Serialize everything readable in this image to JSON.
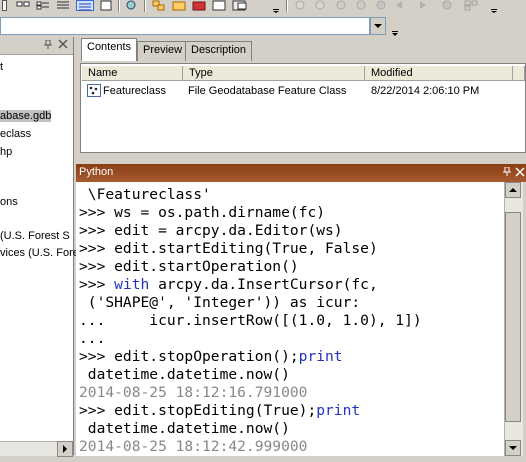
{
  "toolbar": {
    "icons": [
      "view-list-icon",
      "view-details-icon",
      "view-thumbnails-icon",
      "connect-icon",
      "tree-icon",
      "delete-icon",
      "refresh-icon",
      "zoom-in-icon",
      "zoom-out-icon",
      "pan-icon",
      "stop-icon",
      "back-icon",
      "forward-icon",
      "info-icon",
      "grid-icon"
    ]
  },
  "tree": {
    "items": [
      {
        "label": "t"
      },
      {
        "label": "abase.gdb",
        "selected": true
      },
      {
        "label": "eclass"
      },
      {
        "label": "hp"
      },
      {
        "label": "ons"
      },
      {
        "label": "(U.S. Forest S"
      },
      {
        "label": "vices (U.S. Fore"
      }
    ]
  },
  "tabs": [
    {
      "label": "Contents",
      "active": true
    },
    {
      "label": "Preview",
      "active": false
    },
    {
      "label": "Description",
      "active": false
    }
  ],
  "list": {
    "columns": [
      "Name",
      "Type",
      "Modified"
    ],
    "rows": [
      {
        "name": "Featureclass",
        "type": "File Geodatabase Feature Class",
        "modified": "8/22/2014 2:06:10 PM"
      }
    ]
  },
  "python": {
    "title": "Python",
    "lines": [
      " \\Featureclass'",
      ">>> ws = os.path.dirname(fc)",
      ">>> edit = arcpy.da.Editor(ws)",
      ">>> edit.startEditing(True, False)",
      ">>> edit.startOperation()",
      {
        "pre": ">>> ",
        "kw": "with",
        "post": " arcpy.da.InsertCursor(fc,"
      },
      " ('SHAPE@', 'Integer')) as icur:",
      "...     icur.insertRow([(1.0, 1.0), 1])",
      "...",
      {
        "pre": ">>> edit.stopOperation();",
        "kw": "print",
        "post": ""
      },
      " datetime.datetime.now()",
      {
        "out": "2014-08-25 18:12:16.791000"
      },
      {
        "pre": ">>> edit.stopEditing(True);",
        "kw": "print",
        "post": ""
      },
      " datetime.datetime.now()",
      {
        "out": "2014-08-25 18:12:42.999000"
      }
    ]
  },
  "colors": {
    "python_title": "#8a3e16",
    "keyword": "#2233bb",
    "output": "#888888"
  }
}
